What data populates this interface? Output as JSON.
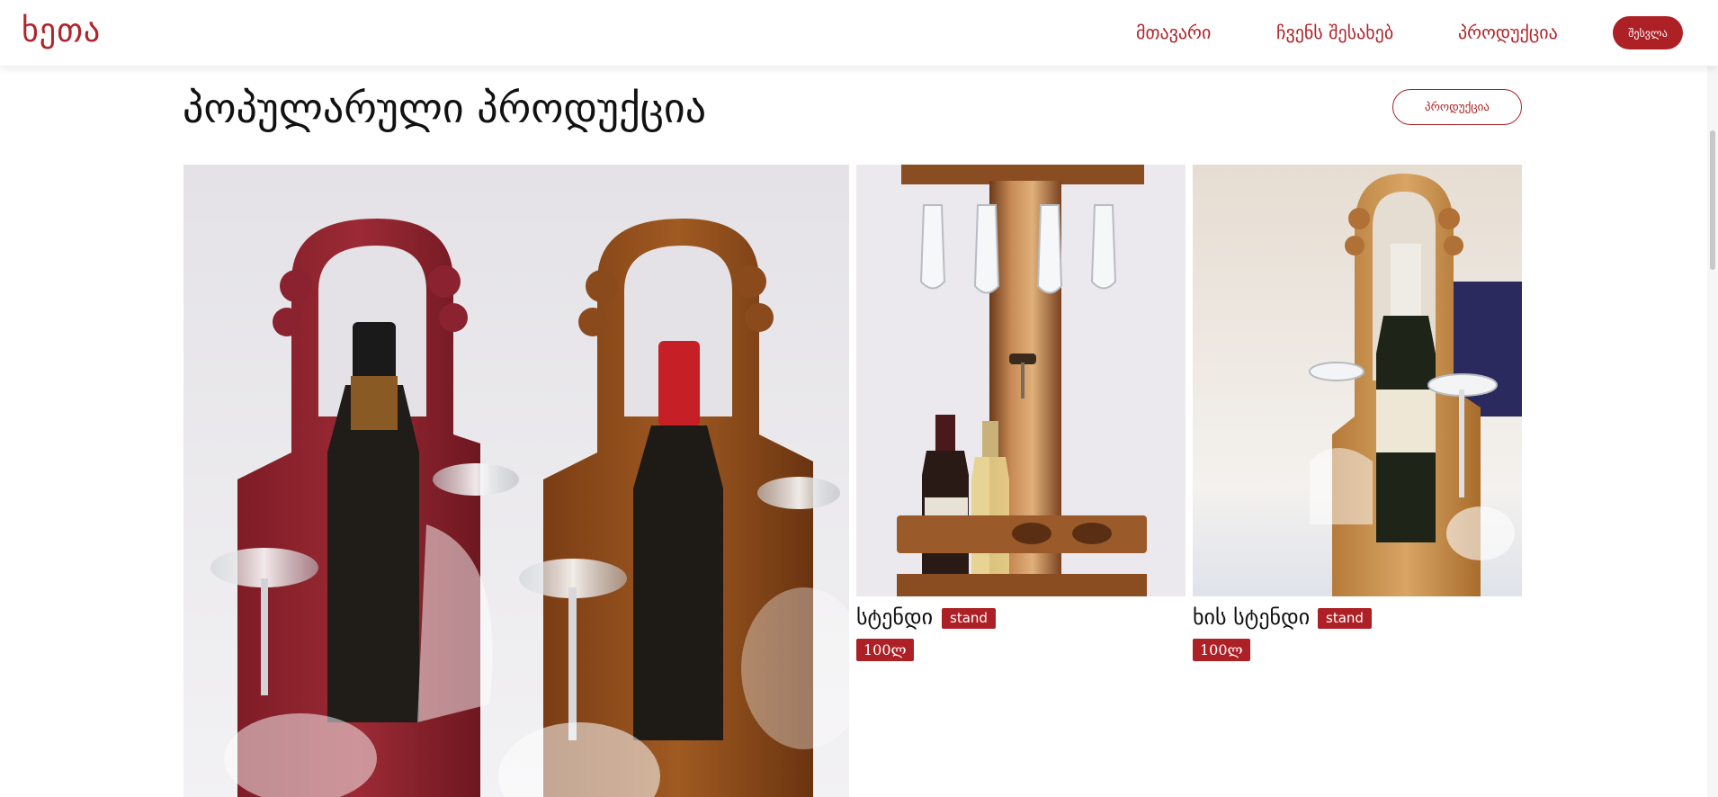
{
  "header": {
    "logo": "ხეთა",
    "nav": [
      "მთავარი",
      "ჩვენს შესახებ",
      "პროდუქცია"
    ],
    "login_label": "შესვლა"
  },
  "section": {
    "title": "პოპულარული პროდუქცია",
    "products_button": "პროდუქცია"
  },
  "products": [
    {
      "title": "სტენდი",
      "badge": "stand",
      "price": "100ლ"
    },
    {
      "title": "ხის სტენდი",
      "badge": "stand",
      "price": "100ლ"
    }
  ],
  "colors": {
    "brand": "#ad2126",
    "text": "#111111"
  },
  "icons": {
    "logo": "brand-wordmark"
  }
}
